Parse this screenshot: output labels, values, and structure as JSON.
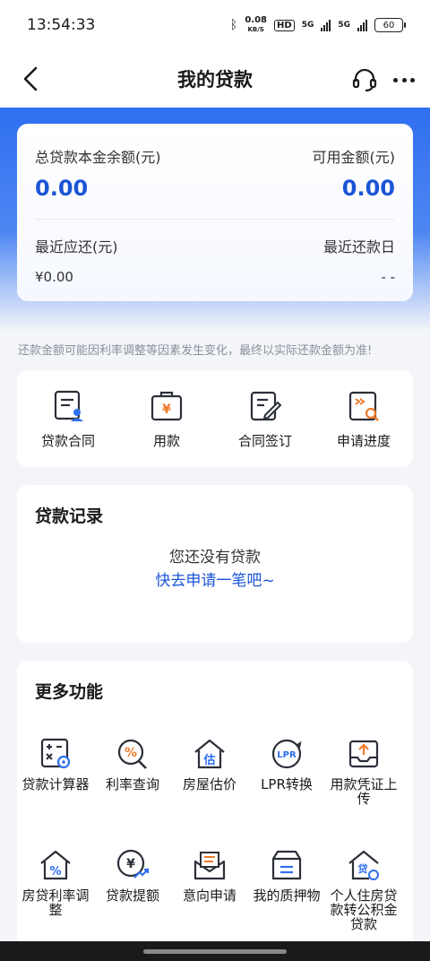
{
  "status": {
    "time": "13:54:33",
    "speed_value": "0.08",
    "speed_unit": "KB/S",
    "hd": "HD",
    "net1": "5G",
    "net2": "5G",
    "battery": "60"
  },
  "nav": {
    "title": "我的贷款"
  },
  "summary": {
    "principal_label": "总贷款本金余额(元)",
    "principal_value": "0.00",
    "available_label": "可用金额(元)",
    "available_value": "0.00",
    "recent_due_label": "最近应还(元)",
    "recent_due_value": "¥0.00",
    "recent_date_label": "最近还款日",
    "recent_date_value": "- -"
  },
  "notice": "还款金额可能因利率调整等因素发生变化，最终以实际还款金额为准!",
  "quick_actions": [
    {
      "label": "贷款合同",
      "icon": "contract-icon"
    },
    {
      "label": "用款",
      "icon": "use-funds-icon"
    },
    {
      "label": "合同签订",
      "icon": "sign-contract-icon"
    },
    {
      "label": "申请进度",
      "icon": "progress-icon"
    }
  ],
  "records": {
    "title": "贷款记录",
    "empty_text": "您还没有贷款",
    "apply_link": "快去申请一笔吧~"
  },
  "more": {
    "title": "更多功能",
    "row1": [
      {
        "label": "贷款计算器",
        "icon": "calculator-icon"
      },
      {
        "label": "利率查询",
        "icon": "rate-query-icon"
      },
      {
        "label": "房屋估价",
        "icon": "house-valuation-icon"
      },
      {
        "label": "LPR转换",
        "icon": "lpr-icon"
      },
      {
        "label": "用款凭证上传",
        "icon": "upload-icon"
      }
    ],
    "row2": [
      {
        "label": "房贷利率调整",
        "icon": "mortgage-rate-icon"
      },
      {
        "label": "贷款提额",
        "icon": "limit-increase-icon"
      },
      {
        "label": "意向申请",
        "icon": "intent-apply-icon"
      },
      {
        "label": "我的质押物",
        "icon": "collateral-icon"
      },
      {
        "label": "个人住房贷款转公积金贷款",
        "icon": "housing-transfer-icon"
      }
    ]
  },
  "colors": {
    "accent": "#1b55d6",
    "icon_orange": "#f07a2a",
    "icon_dark": "#2b2f38",
    "icon_blue": "#2f6ff0"
  }
}
